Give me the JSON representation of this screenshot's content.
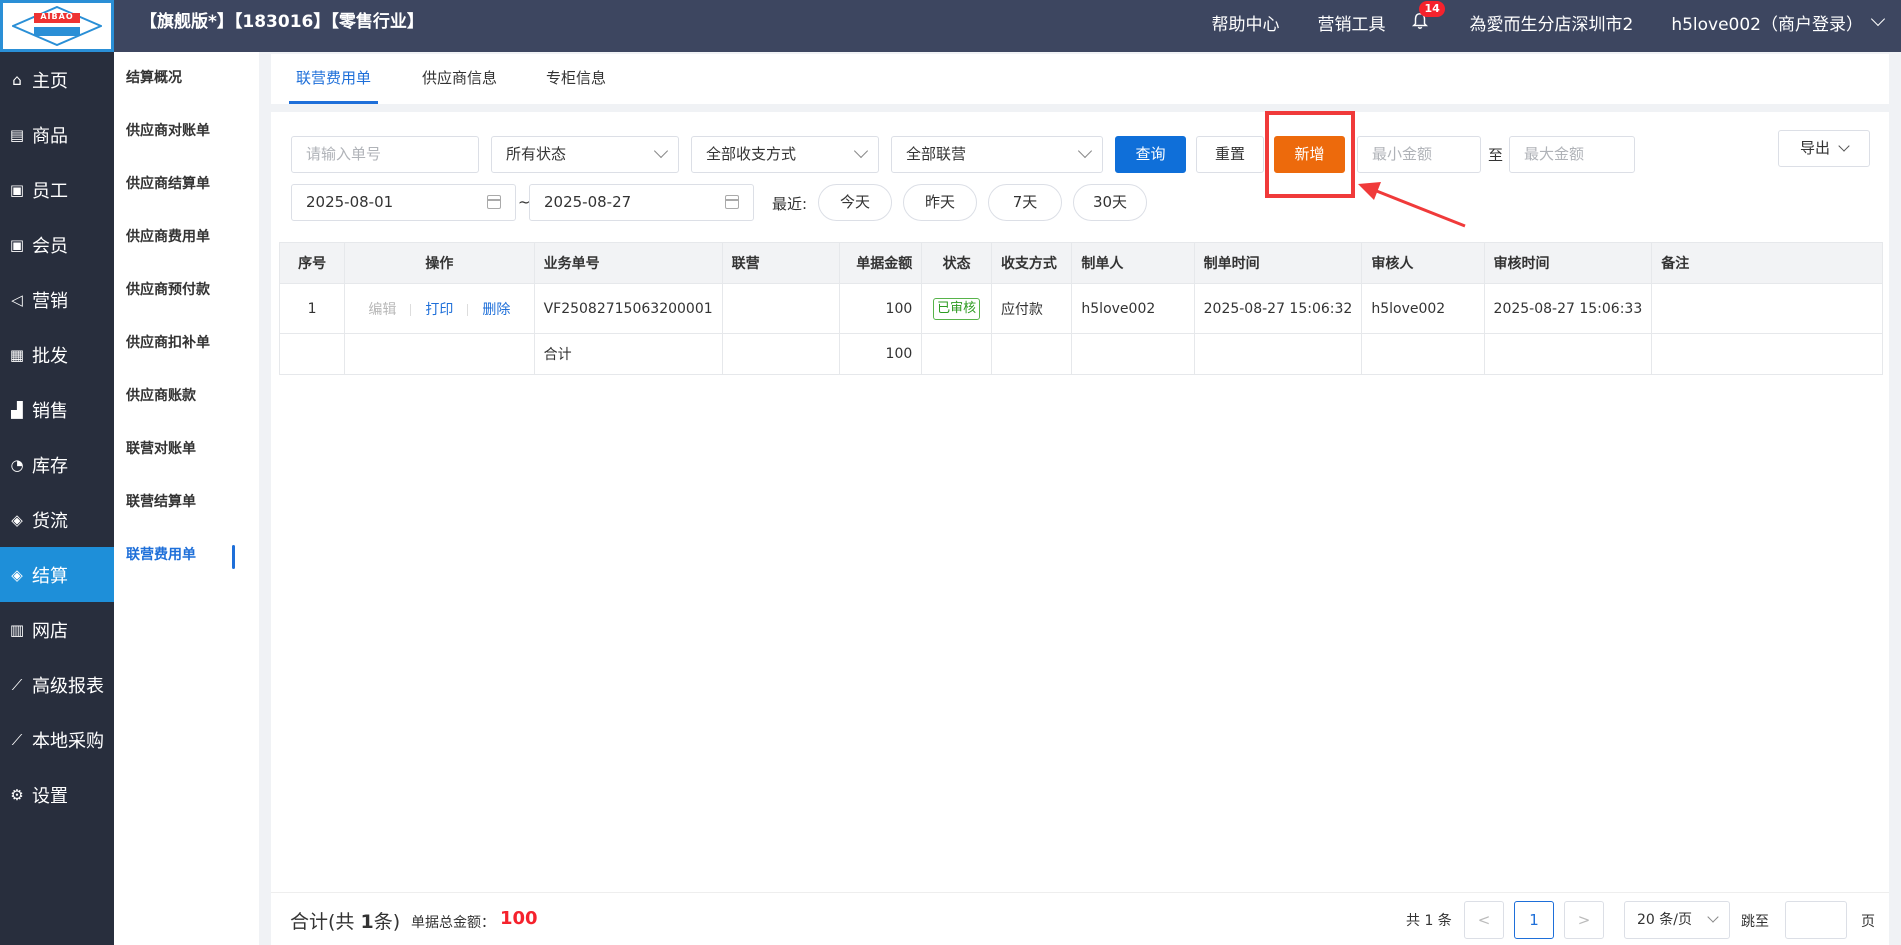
{
  "topbar": {
    "logo_text": "AIBAO",
    "logo_sub": "爱 宝",
    "version": "【旗舰版*】【183016】【零售行业】",
    "help": "帮助中心",
    "marketing_tools": "营销工具",
    "notification_count": "14",
    "store": "為愛而生分店深圳市2",
    "user": "h5love002（商户登录）"
  },
  "nav": [
    {
      "label": "主页",
      "icon": "home-icon",
      "glyph": "⌂"
    },
    {
      "label": "商品",
      "icon": "goods-icon",
      "glyph": "▤"
    },
    {
      "label": "员工",
      "icon": "staff-icon",
      "glyph": "▣"
    },
    {
      "label": "会员",
      "icon": "member-icon",
      "glyph": "▣"
    },
    {
      "label": "营销",
      "icon": "megaphone-icon",
      "glyph": "◁"
    },
    {
      "label": "批发",
      "icon": "wholesale-icon",
      "glyph": "▦"
    },
    {
      "label": "销售",
      "icon": "sales-chart-icon",
      "glyph": "▟"
    },
    {
      "label": "库存",
      "icon": "inventory-pie-icon",
      "glyph": "◔"
    },
    {
      "label": "货流",
      "icon": "logistics-icon",
      "glyph": "◈"
    },
    {
      "label": "结算",
      "icon": "settlement-icon",
      "glyph": "◈"
    },
    {
      "label": "网店",
      "icon": "gift-icon",
      "glyph": "▥"
    },
    {
      "label": "高级报表",
      "icon": "report-icon",
      "glyph": "⟋"
    },
    {
      "label": "本地采购",
      "icon": "purchase-icon",
      "glyph": "⟋"
    },
    {
      "label": "设置",
      "icon": "gear-icon",
      "glyph": "⚙"
    }
  ],
  "subnav": [
    "结算概况",
    "供应商对账单",
    "供应商结算单",
    "供应商费用单",
    "供应商预付款",
    "供应商扣补单",
    "供应商账款",
    "联营对账单",
    "联营结算单",
    "联营费用单"
  ],
  "tabs": [
    "联营费用单",
    "供应商信息",
    "专柜信息"
  ],
  "filters": {
    "order_no_placeholder": "请输入单号",
    "status": "所有状态",
    "payment": "全部收支方式",
    "joint": "全部联营",
    "query": "查询",
    "reset": "重置",
    "add": "新增",
    "min_placeholder": "最小金额",
    "to": "至",
    "max_placeholder": "最大金额",
    "export": "导出",
    "date_from": "2025-08-01",
    "date_sep": "~",
    "date_to": "2025-08-27",
    "recent": "最近:",
    "today": "今天",
    "yesterday": "昨天",
    "d7": "7天",
    "d30": "30天"
  },
  "table": {
    "headers": [
      "序号",
      "操作",
      "业务单号",
      "联营",
      "单据金额",
      "状态",
      "收支方式",
      "制单人",
      "制单时间",
      "审核人",
      "审核时间",
      "备注"
    ],
    "row": {
      "index": "1",
      "edit": "编辑",
      "print": "打印",
      "delete": "删除",
      "order_no": "VF25082715063200001",
      "joint": "",
      "amount": "100",
      "status": "已审核",
      "payment": "应付款",
      "creator": "h5love002",
      "created_at": "2025-08-27 15:06:32",
      "auditor": "h5love002",
      "audited_at": "2025-08-27 15:06:33",
      "remark": ""
    },
    "total_label": "合计",
    "total_amount": "100"
  },
  "footer": {
    "sum_prefix": "合计(共 ",
    "sum_count": "1",
    "sum_suffix": "条)",
    "amount_label": "单据总金额：",
    "amount_value": "100",
    "pager_total": "共 1 条",
    "prev": "<",
    "page": "1",
    "next": ">",
    "page_size": "20 条/页",
    "jump": "跳至",
    "page_unit": "页"
  },
  "colors": {
    "accent": "#1e6fd9",
    "add_button": "#ed6a0c",
    "highlight_box": "#f03a3a",
    "topbar": "#3d4660",
    "sidebar": "#282e3d"
  }
}
